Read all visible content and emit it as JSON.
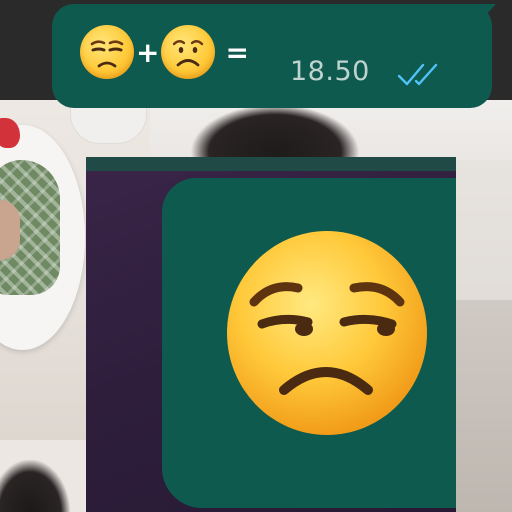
{
  "message": {
    "emojis": [
      "unamused-face-icon",
      "frowning-face-icon"
    ],
    "plus": "+",
    "equals": "=",
    "amount": "18.50",
    "status": "read-double-check-icon"
  },
  "colors": {
    "bubble": "#0e5a4e",
    "amount_text": "#bfd3cf",
    "read_ticks": "#4fc3f7",
    "panel_bg": "#2e1e3c"
  }
}
